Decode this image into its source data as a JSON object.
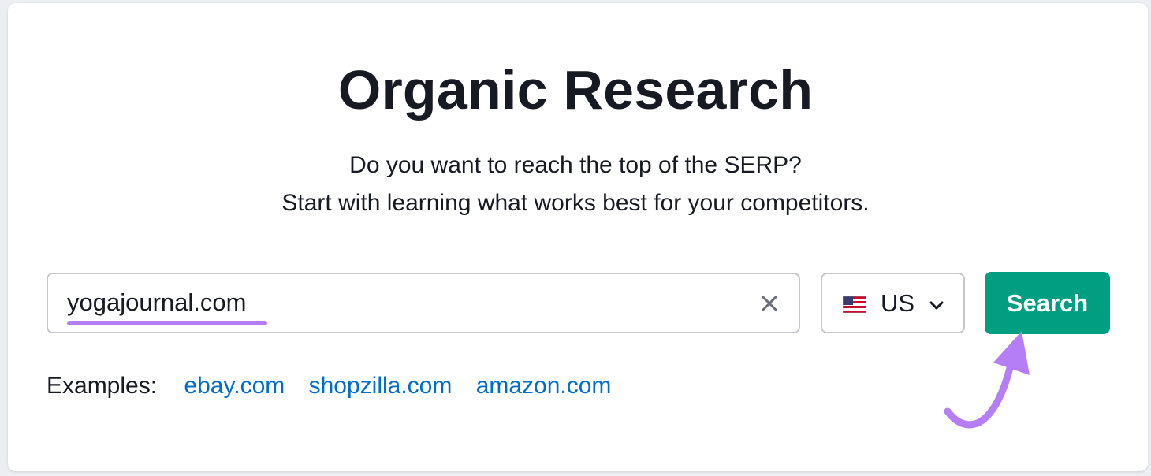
{
  "header": {
    "title": "Organic Research",
    "subtitle_line1": "Do you want to reach the top of the SERP?",
    "subtitle_line2": "Start with learning what works best for your competitors."
  },
  "search": {
    "value": "yogajournal.com",
    "clear_icon": "close-icon"
  },
  "country": {
    "flag_icon": "us-flag-icon",
    "label": "US",
    "dropdown_icon": "chevron-down-icon"
  },
  "search_button": {
    "label": "Search",
    "color": "#009f81"
  },
  "examples": {
    "label": "Examples:",
    "links": [
      "ebay.com",
      "shopzilla.com",
      "amazon.com"
    ],
    "link_color": "#006dca"
  },
  "annotation": {
    "highlight_color": "#b57ef7",
    "arrow_icon": "curved-arrow-icon"
  }
}
